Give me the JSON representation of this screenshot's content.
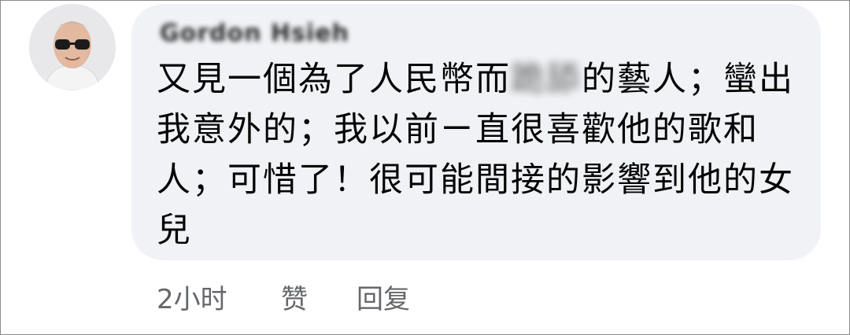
{
  "comment": {
    "author": "Gordon Hsieh",
    "text_part1": "又見一個為了人民幣而",
    "text_redacted": "跪舔",
    "text_part2": "的藝人；蠻出",
    "line2": "我意外的；我以前ㄧ直很喜歡他的歌和",
    "line3": "人；可惜了！很可能間接的影響到他的女",
    "line4": "兒"
  },
  "actions": {
    "time": "2小时",
    "like": "赞",
    "reply": "回复"
  }
}
